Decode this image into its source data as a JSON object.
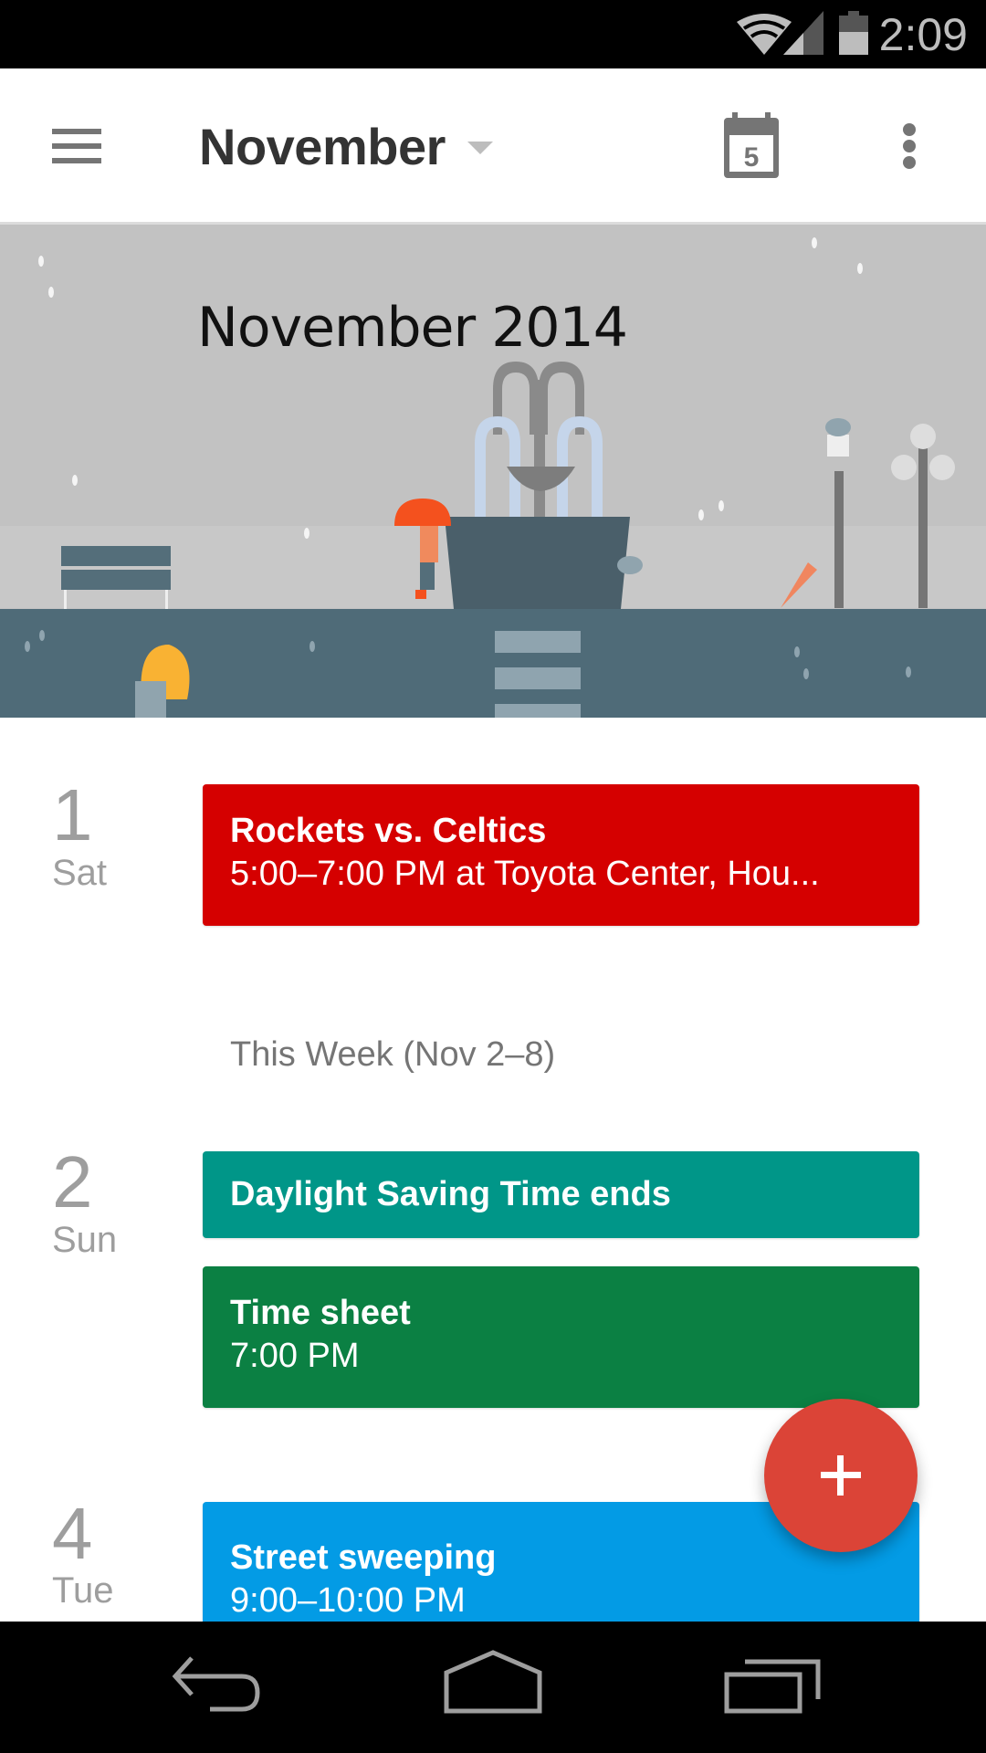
{
  "status_bar": {
    "time": "2:09",
    "icons": [
      "wifi-icon",
      "cell-signal-icon",
      "battery-icon"
    ]
  },
  "toolbar": {
    "title": "November",
    "menu_icon": "hamburger-menu-icon",
    "dropdown_icon": "dropdown-arrow-icon",
    "today_icon": "calendar-today-icon",
    "today_day": "5",
    "overflow_icon": "more-vert-icon"
  },
  "banner": {
    "title": "November 2014",
    "illustration": "rainy-park-illustration"
  },
  "agenda": {
    "days": [
      {
        "day_number": "1",
        "day_name": "Sat",
        "events": [
          {
            "title": "Rockets vs. Celtics",
            "subtitle": "5:00–7:00 PM at Toyota Center, Hou...",
            "color": "#d50000"
          }
        ]
      },
      {
        "day_number": "2",
        "day_name": "Sun",
        "events": [
          {
            "title": "Daylight Saving Time ends",
            "subtitle": "",
            "color": "#009688"
          },
          {
            "title": "Time sheet",
            "subtitle": "7:00 PM",
            "color": "#0b8043"
          }
        ]
      },
      {
        "day_number": "4",
        "day_name": "Tue",
        "events": [
          {
            "title": "Street sweeping",
            "subtitle": "9:00–10:00 PM",
            "color": "#039be5"
          }
        ]
      }
    ],
    "week_header": "This Week (Nov 2–8)"
  },
  "fab": {
    "icon": "plus-icon",
    "color": "#db4437"
  },
  "nav_bar": {
    "buttons": [
      "back-icon",
      "home-icon",
      "recents-icon"
    ]
  }
}
